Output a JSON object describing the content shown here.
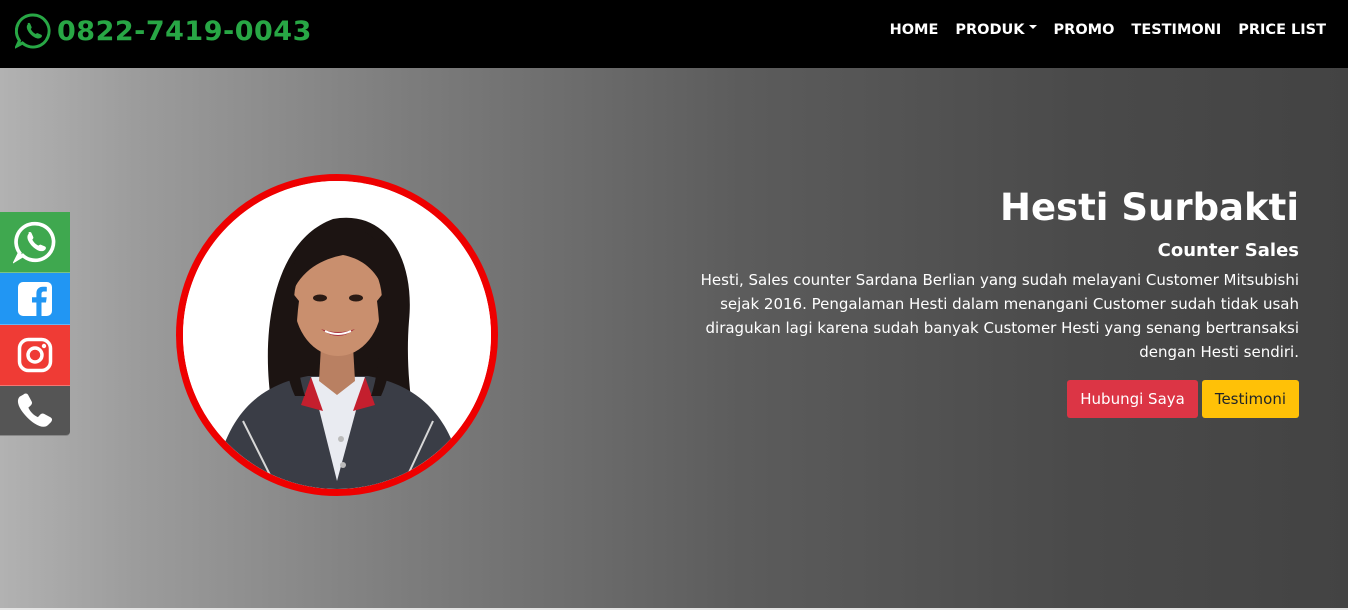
{
  "navbar": {
    "phone": "0822-7419-0043",
    "items": [
      {
        "label": "HOME"
      },
      {
        "label": "PRODUK"
      },
      {
        "label": "PROMO"
      },
      {
        "label": "TESTIMONI"
      },
      {
        "label": "PRICE LIST"
      }
    ]
  },
  "profile": {
    "name": "Hesti Surbakti",
    "role": "Counter Sales",
    "description": "Hesti, Sales counter Sardana Berlian yang sudah melayani Customer Mitsubishi sejak 2016. Pengalaman Hesti dalam menangani Customer sudah tidak usah diragukan lagi karena sudah banyak Customer Hesti yang senang bertransaksi dengan Hesti sendiri.",
    "contact_button": "Hubungi Saya",
    "testimoni_button": "Testimoni"
  },
  "social": [
    {
      "icon": "whatsapp-icon"
    },
    {
      "icon": "facebook-icon"
    },
    {
      "icon": "instagram-icon"
    },
    {
      "icon": "phone-icon"
    }
  ],
  "colors": {
    "brand_green": "#28a745",
    "avatar_border": "#ee0000",
    "button_red": "#dc3545",
    "button_yellow": "#ffc107"
  }
}
